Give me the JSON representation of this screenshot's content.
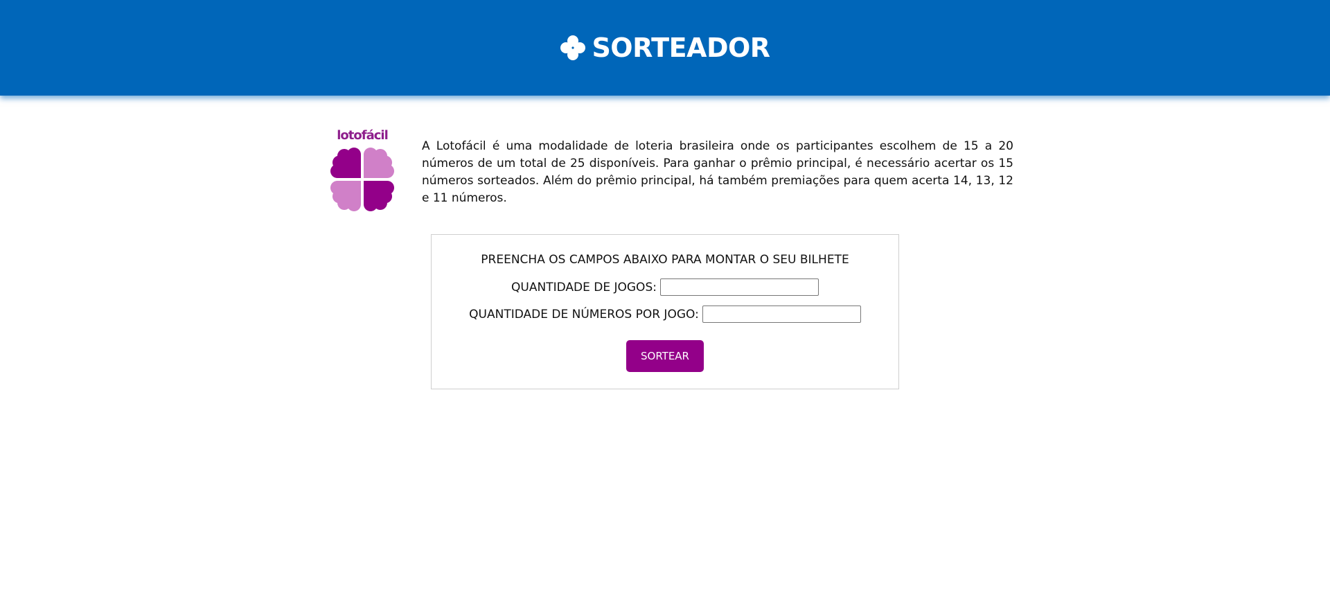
{
  "header": {
    "icon": "clover-icon",
    "title": "SORTEADOR",
    "background": "#0066b9"
  },
  "intro": {
    "logo_text": "lotofácil",
    "logo_color": "#930089",
    "description": "A Lotofácil é uma modalidade de loteria brasileira onde os participantes escolhem de 15 a 20 números de um total de 25 disponíveis. Para ganhar o prêmio principal, é necessário acertar os 15 números sorteados. Além do prêmio principal, há também premiações para quem acerta 14, 13, 12 e 11 números."
  },
  "form": {
    "heading": "PREENCHA OS CAMPOS ABAIXO PARA MONTAR O SEU BILHETE",
    "games_label": "QUANTIDADE DE JOGOS:",
    "games_value": "",
    "numbers_label": "QUANTIDADE DE NÚMEROS POR JOGO:",
    "numbers_value": "",
    "submit_label": "SORTEAR",
    "submit_color": "#930089"
  }
}
